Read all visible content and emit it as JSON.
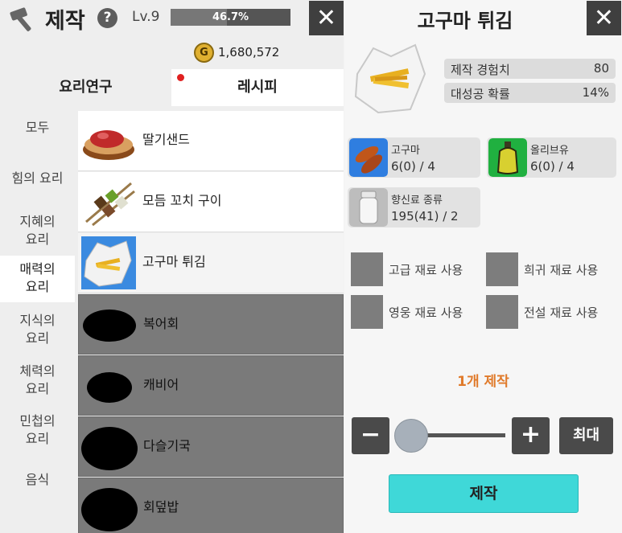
{
  "header": {
    "title": "제작",
    "help_label": "?",
    "level": "Lv.9",
    "exp_percent": "46.7%",
    "exp_fraction": 0.467,
    "close_label": "✕"
  },
  "currency": {
    "coin_label": "G",
    "gold": "1,680,572"
  },
  "tabs": {
    "research": "요리연구",
    "recipe": "레시피"
  },
  "sidebar": {
    "items": [
      {
        "label": "모두"
      },
      {
        "label": "힘의 요리"
      },
      {
        "label": "지혜의\n요리"
      },
      {
        "label": "매력의\n요리"
      },
      {
        "label": "지식의\n요리"
      },
      {
        "label": "체력의\n요리"
      },
      {
        "label": "민첩의\n요리"
      },
      {
        "label": "음식"
      }
    ],
    "active_index": 3
  },
  "recipes": [
    {
      "name": "딸기샌드",
      "locked": false
    },
    {
      "name": "모듬 꼬치 구이",
      "locked": false
    },
    {
      "name": "고구마 튀김",
      "locked": false,
      "selected": true
    },
    {
      "name": "복어회",
      "locked": true
    },
    {
      "name": "캐비어",
      "locked": true
    },
    {
      "name": "다슬기국",
      "locked": true
    },
    {
      "name": "회덮밥",
      "locked": true
    }
  ],
  "detail": {
    "title": "고구마 튀김",
    "close_label": "✕",
    "exp_label": "제작 경험치",
    "exp_value": "80",
    "crit_label": "대성공 확률",
    "crit_value": "14%",
    "ingredients": [
      {
        "name": "고구마",
        "qty": "6(0) / 4",
        "icon": "sweet-potato-icon"
      },
      {
        "name": "올리브유",
        "qty": "6(0) / 4",
        "icon": "olive-oil-icon"
      },
      {
        "name": "향신료 종류",
        "qty": "195(41) / 2",
        "icon": "spice-jar-icon"
      }
    ],
    "options": [
      {
        "label": "고급 재료 사용"
      },
      {
        "label": "희귀 재료 사용"
      },
      {
        "label": "영웅 재료 사용"
      },
      {
        "label": "전설 재료 사용"
      }
    ],
    "craft_count": "1개 제작",
    "minus_label": "−",
    "plus_label": "+",
    "max_label": "최대",
    "craft_label": "제작"
  },
  "colors": {
    "accent_cyan": "#3fd8d8",
    "count_orange": "#e07a2a",
    "dark_button": "#4a4a4a"
  }
}
